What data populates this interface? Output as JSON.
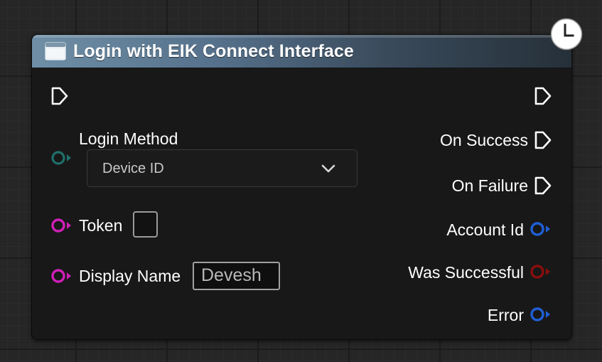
{
  "node": {
    "title": "Login with EIK Connect Interface",
    "header_icon": "function-node-icon",
    "latent_icon": "clock-icon"
  },
  "inputs": {
    "login_method": {
      "label": "Login Method",
      "value": "Device ID",
      "pin_color": "#1f6f6b"
    },
    "token": {
      "label": "Token",
      "checked": false,
      "pin_color": "#d01fb8"
    },
    "display_name": {
      "label": "Display Name",
      "value": "Devesh",
      "pin_color": "#d01fb8"
    }
  },
  "outputs": {
    "on_success": {
      "label": "On Success"
    },
    "on_failure": {
      "label": "On Failure"
    },
    "account_id": {
      "label": "Account Id",
      "pin_color": "#1f5fd6"
    },
    "was_successful": {
      "label": "Was Successful",
      "pin_color": "#8a0e0e"
    },
    "error": {
      "label": "Error",
      "pin_color": "#1f5fd6"
    }
  },
  "colors": {
    "header_gradient_start": "#6f8fa6",
    "header_gradient_end": "#263039",
    "node_body": "#181818",
    "exec_pin": "#ffffff"
  }
}
